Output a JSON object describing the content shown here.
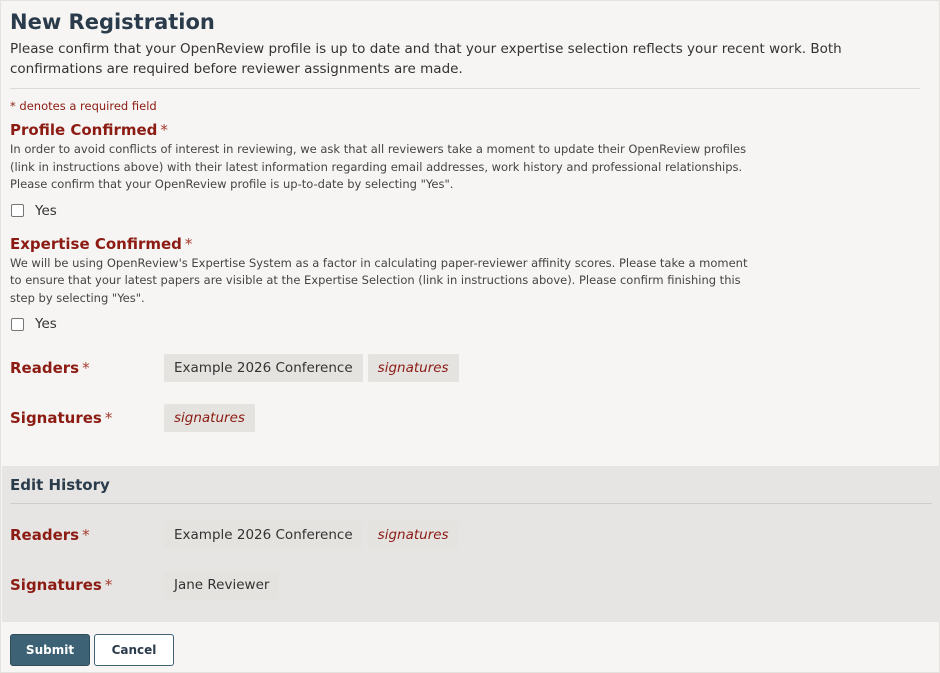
{
  "page": {
    "title": "New Registration",
    "description": "Please confirm that your OpenReview profile is up to date and that your expertise selection reflects your recent work. Both confirmations are required before reviewer assignments are made.",
    "required_note": "* denotes a required field"
  },
  "fields": {
    "profile": {
      "title": "Profile Confirmed",
      "star": "*",
      "description": "In order to avoid conflicts of interest in reviewing, we ask that all reviewers take a moment to update their OpenReview profiles (link in instructions above) with their latest information regarding email addresses, work history and professional relationships. Please confirm that your OpenReview profile is up-to-date by selecting \"Yes\".",
      "option": "Yes",
      "checked": false
    },
    "expertise": {
      "title": "Expertise Confirmed",
      "star": "*",
      "description": "We will be using OpenReview's Expertise System as a factor in calculating paper-reviewer affinity scores. Please take a moment to ensure that your latest papers are visible at the Expertise Selection (link in instructions above). Please confirm finishing this step by selecting \"Yes\".",
      "option": "Yes",
      "checked": false
    },
    "readers": {
      "label": "Readers",
      "star": "*",
      "values": [
        "Example 2026 Conference",
        "signatures"
      ]
    },
    "signatures": {
      "label": "Signatures",
      "star": "*",
      "values": [
        "signatures"
      ]
    }
  },
  "edit_history": {
    "title": "Edit History",
    "readers": {
      "label": "Readers",
      "star": "*",
      "values": [
        "Example 2026 Conference",
        "signatures"
      ]
    },
    "signatures": {
      "label": "Signatures",
      "star": "*",
      "values": [
        "Jane Reviewer"
      ]
    }
  },
  "buttons": {
    "submit": "Submit",
    "cancel": "Cancel"
  },
  "colors": {
    "title": "#2a3b4b",
    "required": "#8c1b13",
    "submit_bg": "#3e6275",
    "chip_bg": "#e4e3e0"
  }
}
